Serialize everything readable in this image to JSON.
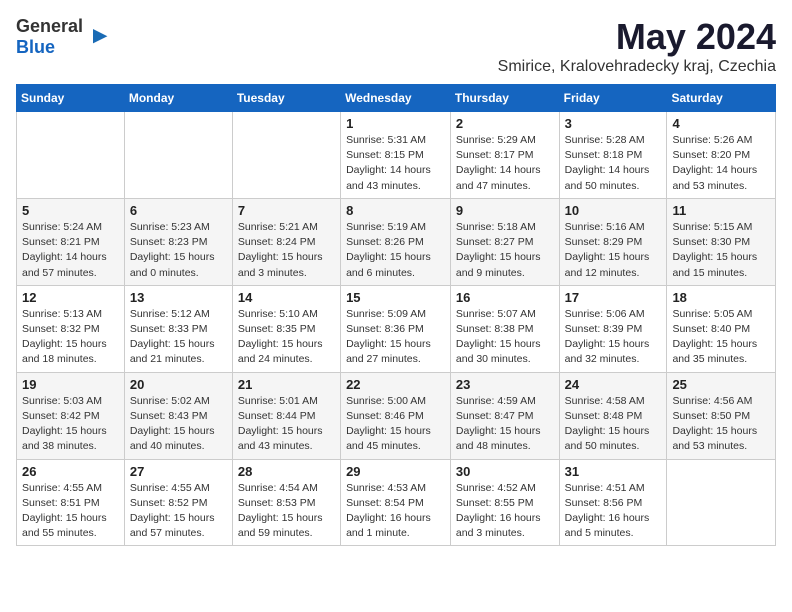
{
  "header": {
    "logo_general": "General",
    "logo_blue": "Blue",
    "month": "May 2024",
    "location": "Smirice, Kralovehradecky kraj, Czechia"
  },
  "weekdays": [
    "Sunday",
    "Monday",
    "Tuesday",
    "Wednesday",
    "Thursday",
    "Friday",
    "Saturday"
  ],
  "weeks": [
    [
      {
        "day": "",
        "sunrise": "",
        "sunset": "",
        "daylight": ""
      },
      {
        "day": "",
        "sunrise": "",
        "sunset": "",
        "daylight": ""
      },
      {
        "day": "",
        "sunrise": "",
        "sunset": "",
        "daylight": ""
      },
      {
        "day": "1",
        "sunrise": "Sunrise: 5:31 AM",
        "sunset": "Sunset: 8:15 PM",
        "daylight": "Daylight: 14 hours and 43 minutes."
      },
      {
        "day": "2",
        "sunrise": "Sunrise: 5:29 AM",
        "sunset": "Sunset: 8:17 PM",
        "daylight": "Daylight: 14 hours and 47 minutes."
      },
      {
        "day": "3",
        "sunrise": "Sunrise: 5:28 AM",
        "sunset": "Sunset: 8:18 PM",
        "daylight": "Daylight: 14 hours and 50 minutes."
      },
      {
        "day": "4",
        "sunrise": "Sunrise: 5:26 AM",
        "sunset": "Sunset: 8:20 PM",
        "daylight": "Daylight: 14 hours and 53 minutes."
      }
    ],
    [
      {
        "day": "5",
        "sunrise": "Sunrise: 5:24 AM",
        "sunset": "Sunset: 8:21 PM",
        "daylight": "Daylight: 14 hours and 57 minutes."
      },
      {
        "day": "6",
        "sunrise": "Sunrise: 5:23 AM",
        "sunset": "Sunset: 8:23 PM",
        "daylight": "Daylight: 15 hours and 0 minutes."
      },
      {
        "day": "7",
        "sunrise": "Sunrise: 5:21 AM",
        "sunset": "Sunset: 8:24 PM",
        "daylight": "Daylight: 15 hours and 3 minutes."
      },
      {
        "day": "8",
        "sunrise": "Sunrise: 5:19 AM",
        "sunset": "Sunset: 8:26 PM",
        "daylight": "Daylight: 15 hours and 6 minutes."
      },
      {
        "day": "9",
        "sunrise": "Sunrise: 5:18 AM",
        "sunset": "Sunset: 8:27 PM",
        "daylight": "Daylight: 15 hours and 9 minutes."
      },
      {
        "day": "10",
        "sunrise": "Sunrise: 5:16 AM",
        "sunset": "Sunset: 8:29 PM",
        "daylight": "Daylight: 15 hours and 12 minutes."
      },
      {
        "day": "11",
        "sunrise": "Sunrise: 5:15 AM",
        "sunset": "Sunset: 8:30 PM",
        "daylight": "Daylight: 15 hours and 15 minutes."
      }
    ],
    [
      {
        "day": "12",
        "sunrise": "Sunrise: 5:13 AM",
        "sunset": "Sunset: 8:32 PM",
        "daylight": "Daylight: 15 hours and 18 minutes."
      },
      {
        "day": "13",
        "sunrise": "Sunrise: 5:12 AM",
        "sunset": "Sunset: 8:33 PM",
        "daylight": "Daylight: 15 hours and 21 minutes."
      },
      {
        "day": "14",
        "sunrise": "Sunrise: 5:10 AM",
        "sunset": "Sunset: 8:35 PM",
        "daylight": "Daylight: 15 hours and 24 minutes."
      },
      {
        "day": "15",
        "sunrise": "Sunrise: 5:09 AM",
        "sunset": "Sunset: 8:36 PM",
        "daylight": "Daylight: 15 hours and 27 minutes."
      },
      {
        "day": "16",
        "sunrise": "Sunrise: 5:07 AM",
        "sunset": "Sunset: 8:38 PM",
        "daylight": "Daylight: 15 hours and 30 minutes."
      },
      {
        "day": "17",
        "sunrise": "Sunrise: 5:06 AM",
        "sunset": "Sunset: 8:39 PM",
        "daylight": "Daylight: 15 hours and 32 minutes."
      },
      {
        "day": "18",
        "sunrise": "Sunrise: 5:05 AM",
        "sunset": "Sunset: 8:40 PM",
        "daylight": "Daylight: 15 hours and 35 minutes."
      }
    ],
    [
      {
        "day": "19",
        "sunrise": "Sunrise: 5:03 AM",
        "sunset": "Sunset: 8:42 PM",
        "daylight": "Daylight: 15 hours and 38 minutes."
      },
      {
        "day": "20",
        "sunrise": "Sunrise: 5:02 AM",
        "sunset": "Sunset: 8:43 PM",
        "daylight": "Daylight: 15 hours and 40 minutes."
      },
      {
        "day": "21",
        "sunrise": "Sunrise: 5:01 AM",
        "sunset": "Sunset: 8:44 PM",
        "daylight": "Daylight: 15 hours and 43 minutes."
      },
      {
        "day": "22",
        "sunrise": "Sunrise: 5:00 AM",
        "sunset": "Sunset: 8:46 PM",
        "daylight": "Daylight: 15 hours and 45 minutes."
      },
      {
        "day": "23",
        "sunrise": "Sunrise: 4:59 AM",
        "sunset": "Sunset: 8:47 PM",
        "daylight": "Daylight: 15 hours and 48 minutes."
      },
      {
        "day": "24",
        "sunrise": "Sunrise: 4:58 AM",
        "sunset": "Sunset: 8:48 PM",
        "daylight": "Daylight: 15 hours and 50 minutes."
      },
      {
        "day": "25",
        "sunrise": "Sunrise: 4:56 AM",
        "sunset": "Sunset: 8:50 PM",
        "daylight": "Daylight: 15 hours and 53 minutes."
      }
    ],
    [
      {
        "day": "26",
        "sunrise": "Sunrise: 4:55 AM",
        "sunset": "Sunset: 8:51 PM",
        "daylight": "Daylight: 15 hours and 55 minutes."
      },
      {
        "day": "27",
        "sunrise": "Sunrise: 4:55 AM",
        "sunset": "Sunset: 8:52 PM",
        "daylight": "Daylight: 15 hours and 57 minutes."
      },
      {
        "day": "28",
        "sunrise": "Sunrise: 4:54 AM",
        "sunset": "Sunset: 8:53 PM",
        "daylight": "Daylight: 15 hours and 59 minutes."
      },
      {
        "day": "29",
        "sunrise": "Sunrise: 4:53 AM",
        "sunset": "Sunset: 8:54 PM",
        "daylight": "Daylight: 16 hours and 1 minute."
      },
      {
        "day": "30",
        "sunrise": "Sunrise: 4:52 AM",
        "sunset": "Sunset: 8:55 PM",
        "daylight": "Daylight: 16 hours and 3 minutes."
      },
      {
        "day": "31",
        "sunrise": "Sunrise: 4:51 AM",
        "sunset": "Sunset: 8:56 PM",
        "daylight": "Daylight: 16 hours and 5 minutes."
      },
      {
        "day": "",
        "sunrise": "",
        "sunset": "",
        "daylight": ""
      }
    ]
  ]
}
